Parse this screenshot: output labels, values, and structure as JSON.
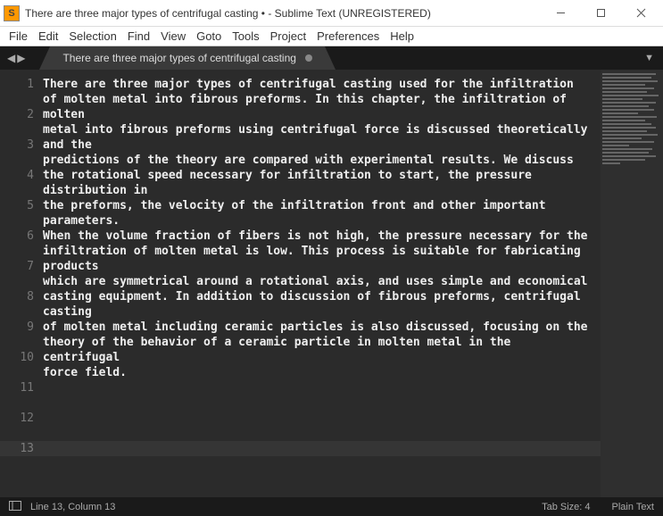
{
  "window": {
    "title": "There are three major types of centrifugal casting • - Sublime Text (UNREGISTERED)"
  },
  "menu": {
    "items": [
      "File",
      "Edit",
      "Selection",
      "Find",
      "View",
      "Goto",
      "Tools",
      "Project",
      "Preferences",
      "Help"
    ]
  },
  "tab": {
    "title": "There are three major types of centrifugal casting"
  },
  "lines": [
    {
      "num": "1",
      "wrap": true,
      "text": "There are three major types of centrifugal casting used for the infiltration"
    },
    {
      "num": "2",
      "wrap": true,
      "text": "of molten metal into fibrous preforms. In this chapter, the infiltration of molten"
    },
    {
      "num": "3",
      "wrap": true,
      "text": "metal into fibrous preforms using centrifugal force is discussed theoretically and the"
    },
    {
      "num": "4",
      "wrap": true,
      "text": "predictions of the theory are compared with experimental results. We discuss"
    },
    {
      "num": "5",
      "wrap": true,
      "text": "the rotational speed necessary for infiltration to start, the pressure distribution in"
    },
    {
      "num": "6",
      "wrap": true,
      "text": "the preforms, the velocity of the infiltration front and other important parameters."
    },
    {
      "num": "7",
      "wrap": true,
      "text": "When the volume fraction of fibers is not high, the pressure necessary for the"
    },
    {
      "num": "8",
      "wrap": true,
      "text": "infiltration of molten metal is low. This process is suitable for fabricating products"
    },
    {
      "num": "9",
      "wrap": true,
      "text": "which are symmetrical around a rotational axis, and uses simple and economical"
    },
    {
      "num": "10",
      "wrap": true,
      "text": "casting equipment. In addition to discussion of fibrous preforms, centrifugal casting"
    },
    {
      "num": "11",
      "wrap": true,
      "text": "of molten metal including ceramic particles is also discussed, focusing on the"
    },
    {
      "num": "12",
      "wrap": true,
      "text": "theory of the behavior of a ceramic particle in molten metal in the centrifugal"
    },
    {
      "num": "13",
      "wrap": false,
      "text": "force field."
    }
  ],
  "status": {
    "position": "Line 13, Column 13",
    "tabsize": "Tab Size: 4",
    "syntax": "Plain Text"
  }
}
